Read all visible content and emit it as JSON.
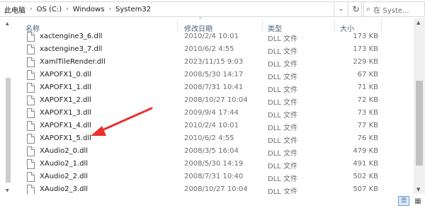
{
  "address_bar": {
    "crumbs": [
      "此电脑",
      "OS (C:)",
      "Windows",
      "System32"
    ],
    "separator": "›"
  },
  "search": {
    "placeholder": "在 Syste..."
  },
  "columns": {
    "name": "名称",
    "date": "修改日期",
    "type": "类型",
    "size": "大小"
  },
  "files": [
    {
      "name": "xactengine3_6.dll",
      "date": "2010/2/4 10:01",
      "type": "DLL 文件",
      "size": "173 KB"
    },
    {
      "name": "xactengine3_7.dll",
      "date": "2010/6/2 4:55",
      "type": "DLL 文件",
      "size": "173 KB"
    },
    {
      "name": "XamlTileRender.dll",
      "date": "2023/11/15 9:03",
      "type": "DLL 文件",
      "size": "229 KB"
    },
    {
      "name": "XAPOFX1_0.dll",
      "date": "2008/5/30 14:17",
      "type": "DLL 文件",
      "size": "67 KB"
    },
    {
      "name": "XAPOFX1_1.dll",
      "date": "2008/7/31 10:41",
      "type": "DLL 文件",
      "size": "71 KB"
    },
    {
      "name": "XAPOFX1_2.dll",
      "date": "2008/10/27 10:04",
      "type": "DLL 文件",
      "size": "72 KB"
    },
    {
      "name": "XAPOFX1_3.dll",
      "date": "2009/9/4 17:44",
      "type": "DLL 文件",
      "size": "73 KB"
    },
    {
      "name": "XAPOFX1_4.dll",
      "date": "2010/2/4 10:01",
      "type": "DLL 文件",
      "size": "77 KB"
    },
    {
      "name": "XAPOFX1_5.dll",
      "date": "2010/6/2 4:55",
      "type": "DLL 文件",
      "size": "76 KB"
    },
    {
      "name": "XAudio2_0.dll",
      "date": "2008/3/5 16:04",
      "type": "DLL 文件",
      "size": "479 KB"
    },
    {
      "name": "XAudio2_1.dll",
      "date": "2008/5/30 14:19",
      "type": "DLL 文件",
      "size": "491 KB"
    },
    {
      "name": "XAudio2_2.dll",
      "date": "2008/7/31 10:40",
      "type": "DLL 文件",
      "size": "502 KB"
    },
    {
      "name": "XAudio2_3.dll",
      "date": "2008/10/27 10:04",
      "type": "DLL 文件",
      "size": "507 KB"
    }
  ],
  "colors": {
    "annotation_arrow": "#e8312c",
    "header_text": "#4c607a",
    "selected_view": "#d9e8f7"
  },
  "icons": {
    "address_dropdown": "chevron-down-icon",
    "refresh": "refresh-icon",
    "search": "search-icon",
    "sort": "sort-up-icon",
    "file": "file-icon",
    "view_details": "details-view-icon",
    "view_tiles": "large-icons-view-icon"
  }
}
